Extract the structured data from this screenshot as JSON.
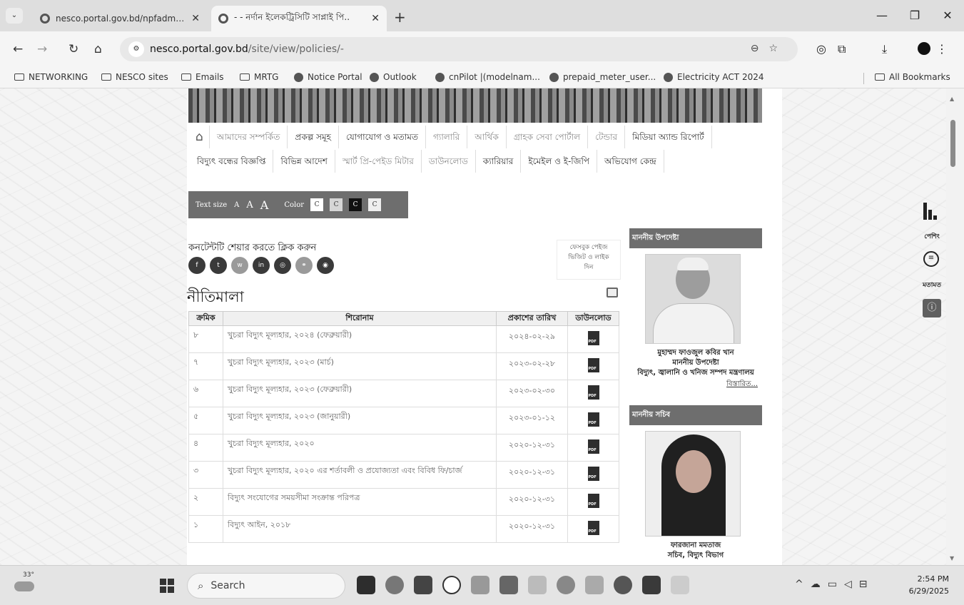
{
  "browser": {
    "tabs": [
      {
        "title": "nesco.portal.gov.bd/npfadmin/",
        "active": false
      },
      {
        "title": "- - নর্দান ইলেকট্রিসিটি সাপ্লাই পি..",
        "active": true
      }
    ],
    "new_tab": "+",
    "window_controls": {
      "minimize": "—",
      "restore": "❐",
      "close": "✕"
    },
    "url_host": "nesco.portal.gov.bd",
    "url_path": "/site/view/policies/-",
    "bookmarks": [
      {
        "label": "NETWORKING",
        "type": "folder"
      },
      {
        "label": "NESCO sites",
        "type": "folder"
      },
      {
        "label": "Emails",
        "type": "folder"
      },
      {
        "label": "MRTG",
        "type": "folder"
      },
      {
        "label": "Notice Portal",
        "type": "link"
      },
      {
        "label": "Outlook",
        "type": "link"
      },
      {
        "label": "cnPilot |(modelnam...",
        "type": "link"
      },
      {
        "label": "prepaid_meter_user...",
        "type": "link"
      },
      {
        "label": "Electricity ACT 2024",
        "type": "link"
      }
    ],
    "all_bookmarks": "All Bookmarks"
  },
  "menu": {
    "row1": [
      {
        "label": "আমাদের সম্পর্কিত",
        "dim": true
      },
      {
        "label": "প্রকল্প সমূহ",
        "dim": false
      },
      {
        "label": "যোগাযোগ ও মতামত",
        "dim": false
      },
      {
        "label": "গ্যালারি",
        "dim": true
      },
      {
        "label": "আর্থিক",
        "dim": true
      },
      {
        "label": "গ্রাহক সেবা পোর্টাল",
        "dim": true
      },
      {
        "label": "টেন্ডার",
        "dim": true
      },
      {
        "label": "মিডিয়া অ্যান্ড রিপোর্ট",
        "dim": false
      }
    ],
    "row2": [
      {
        "label": "বিদ্যুৎ বন্ধের বিজ্ঞপ্তি",
        "dim": false
      },
      {
        "label": "বিভিন্ন আদেশ",
        "dim": false
      },
      {
        "label": "স্মার্ট প্রি-পেইড মিটার",
        "dim": true
      },
      {
        "label": "ডাউনলোড",
        "dim": true
      },
      {
        "label": "ক্যারিয়ার",
        "dim": false
      },
      {
        "label": "ইমেইল ও ই-জিপি",
        "dim": false
      },
      {
        "label": "অভিযোগ কেন্দ্র",
        "dim": false
      }
    ]
  },
  "accessibility": {
    "text_size_label": "Text size",
    "sizes": [
      "A",
      "A",
      "A"
    ],
    "color_label": "Color",
    "swatches": [
      {
        "label": "C",
        "bg": "#ffffff",
        "fg": "#333333"
      },
      {
        "label": "C",
        "bg": "#d6d6d6",
        "fg": "#333333"
      },
      {
        "label": "C",
        "bg": "#111111",
        "fg": "#ffffff"
      },
      {
        "label": "C",
        "bg": "#eeeeee",
        "fg": "#333333"
      }
    ]
  },
  "share": {
    "label": "কনটেন্টটি শেয়ার করতে ক্লিক করুন",
    "buttons": [
      {
        "name": "facebook",
        "glyph": "f",
        "color": "#3a3a3a"
      },
      {
        "name": "twitter",
        "glyph": "t",
        "color": "#3a3a3a"
      },
      {
        "name": "whatsapp",
        "glyph": "w",
        "color": "#9a9a9a"
      },
      {
        "name": "linkedin",
        "glyph": "in",
        "color": "#3a3a3a"
      },
      {
        "name": "instagram",
        "glyph": "◎",
        "color": "#3a3a3a"
      },
      {
        "name": "link",
        "glyph": "⚭",
        "color": "#9a9a9a"
      },
      {
        "name": "messenger",
        "glyph": "◉",
        "color": "#3a3a3a"
      }
    ]
  },
  "facebook_widget": {
    "line1": "ফেসবুক পেইজ",
    "line2": "ভিজিট ও লাইক",
    "line3": "দিন"
  },
  "page": {
    "title": "নীতিমালা",
    "table": {
      "headers": [
        "ক্রমিক",
        "শিরোনাম",
        "প্রকাশের তারিখ",
        "ডাউনলোড"
      ],
      "rows": [
        {
          "sn": "৮",
          "title": "খুচরা বিদ্যুৎ মূল্যহার, ২০২৪ (ফেব্রুয়ারী)",
          "date": "২০২৪-০২-২৯"
        },
        {
          "sn": "৭",
          "title": "খুচরা বিদ্যুৎ মূল্যহার, ২০২৩ (মার্চ)",
          "date": "২০২৩-০২-২৮"
        },
        {
          "sn": "৬",
          "title": "খুচরা বিদ্যুৎ মূল্যহার, ২০২৩ (ফেব্রুয়ারী)",
          "date": "২০২৩-০২-৩০"
        },
        {
          "sn": "৫",
          "title": "খুচরা বিদ্যুৎ মূল্যহার, ২০২৩ (জানুয়ারী)",
          "date": "২০২৩-০১-১২"
        },
        {
          "sn": "৪",
          "title": "খুচরা বিদ্যুৎ মূল্যহার, ২০২০",
          "date": "২০২০-১২-৩১"
        },
        {
          "sn": "৩",
          "title": "খুচরা বিদ্যুৎ মূল্যহার, ২০২০ এর শর্তাবলী ও প্রযোজ্যতা এবং বিবিধ ফি/চার্জ",
          "date": "২০২০-১২-৩১"
        },
        {
          "sn": "২",
          "title": "বিদ্যুৎ সংযোগের সময়সীমা সংক্রান্ত পরিপত্র",
          "date": "২০২০-১২-৩১"
        },
        {
          "sn": "১",
          "title": "বিদ্যুৎ আইন, ২০১৮",
          "date": "২০২০-১২-৩১"
        }
      ],
      "pdf_label": "PDF"
    }
  },
  "sidebar": {
    "adviser": {
      "heading": "মাননীয় উপদেষ্টা",
      "name": "মুহাম্মদ ফাওজুল কবির খান",
      "role": "মাননীয় উপদেষ্টা",
      "ministry": "বিদ্যুৎ, জ্বালানি ও খনিজ সম্পদ মন্ত্রণালয়",
      "more": "বিস্তারিত..."
    },
    "secretary": {
      "heading": "মাননীয় সচিব",
      "name": "ফারজানা মমতাজ",
      "role": "সচিব, বিদ্যুৎ বিভাগ"
    }
  },
  "floating": {
    "ranking_label": "পেশিং",
    "feedback_label": "মতামত"
  },
  "taskbar": {
    "weather_temp": "33°",
    "search_placeholder": "Search",
    "time": "2:54 PM",
    "date": "6/29/2025"
  }
}
